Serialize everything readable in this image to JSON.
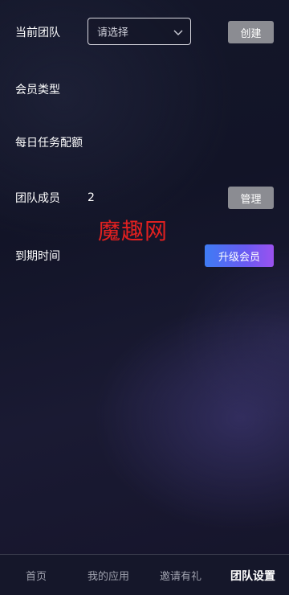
{
  "team": {
    "current_team_label": "当前团队",
    "select_placeholder": "请选择",
    "create_button": "创建",
    "member_type_label": "会员类型",
    "daily_quota_label": "每日任务配额",
    "members_label": "团队成员",
    "members_count": "2",
    "manage_button": "管理",
    "expire_label": "到期时间",
    "upgrade_button": "升级会员"
  },
  "watermark": "魔趣网",
  "tabbar": {
    "items": [
      {
        "label": "首页"
      },
      {
        "label": "我的应用"
      },
      {
        "label": "邀请有礼"
      },
      {
        "label": "团队设置"
      }
    ],
    "active_index": 3
  },
  "colors": {
    "accent_start": "#3f7cf4",
    "accent_end": "#9b52ef",
    "button_gray": "#8b8c92",
    "watermark": "#e02020"
  },
  "icons": {
    "select_arrow": "chevron-down-icon"
  }
}
